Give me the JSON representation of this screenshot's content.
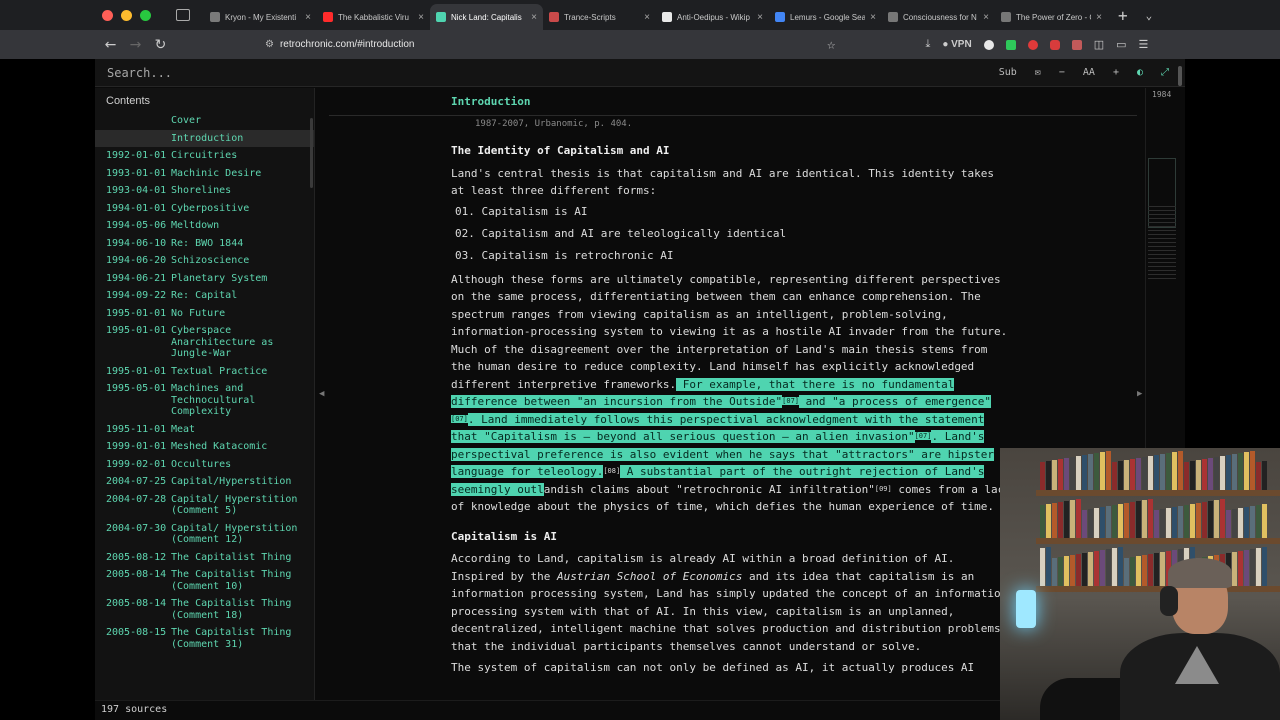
{
  "browser": {
    "tabs": [
      {
        "title": "Kryon - My Existenti",
        "color": "#7a7a7a",
        "active": false
      },
      {
        "title": "The Kabbalistic Viru",
        "color": "#ff2b2b",
        "active": false
      },
      {
        "title": "Nick Land: Capitalis",
        "color": "#4fd4b0",
        "active": true
      },
      {
        "title": "Trance-Scripts",
        "color": "#c94a4a",
        "active": false
      },
      {
        "title": "Anti-Oedipus - Wikip",
        "color": "#e8e8e8",
        "active": false
      },
      {
        "title": "Lemurs - Google Sea",
        "color": "#4285f4",
        "active": false
      },
      {
        "title": "Consciousness for N",
        "color": "#777777",
        "active": false
      },
      {
        "title": "The Power of Zero - Chr",
        "color": "#777777",
        "active": false
      }
    ],
    "url": "retrochronic.com/#introduction",
    "vpn_label": "VPN"
  },
  "app": {
    "search_placeholder": "Search...",
    "toolbar": {
      "sub_label": "Sub",
      "font_label": "AA"
    },
    "sidebar_title": "Contents",
    "toc": [
      {
        "date": "",
        "title": "Cover"
      },
      {
        "date": "",
        "title": "Introduction",
        "active": true
      },
      {
        "date": "1992-01-01",
        "title": "Circuitries"
      },
      {
        "date": "1993-01-01",
        "title": "Machinic Desire"
      },
      {
        "date": "1993-04-01",
        "title": "Shorelines"
      },
      {
        "date": "1994-01-01",
        "title": "Cyberpositive"
      },
      {
        "date": "1994-05-06",
        "title": "Meltdown"
      },
      {
        "date": "1994-06-10",
        "title": "Re: BWO 1844"
      },
      {
        "date": "1994-06-20",
        "title": "Schizoscience"
      },
      {
        "date": "1994-06-21",
        "title": "Planetary System"
      },
      {
        "date": "1994-09-22",
        "title": "Re: Capital"
      },
      {
        "date": "1995-01-01",
        "title": "No Future"
      },
      {
        "date": "1995-01-01",
        "title": "Cyberspace Anarchitecture as Jungle-War"
      },
      {
        "date": "1995-01-01",
        "title": "Textual Practice"
      },
      {
        "date": "1995-05-01",
        "title": "Machines and Technocultural Complexity"
      },
      {
        "date": "1995-11-01",
        "title": "Meat"
      },
      {
        "date": "1999-01-01",
        "title": "Meshed Katacomic"
      },
      {
        "date": "1999-02-01",
        "title": "Occultures"
      },
      {
        "date": "2004-07-25",
        "title": "Capital/Hyperstition"
      },
      {
        "date": "2004-07-28",
        "title": "Capital/ Hyperstition (Comment 5)"
      },
      {
        "date": "2004-07-30",
        "title": "Capital/ Hyperstition (Comment 12)"
      },
      {
        "date": "2005-08-12",
        "title": "The Capitalist Thing"
      },
      {
        "date": "2005-08-14",
        "title": "The Capitalist Thing (Comment 10)"
      },
      {
        "date": "2005-08-14",
        "title": "The Capitalist Thing (Comment 18)"
      },
      {
        "date": "2005-08-15",
        "title": "The Capitalist Thing (Comment 31)"
      }
    ],
    "sources_count": "197 sources",
    "section_title": "Introduction",
    "minimap_year": "1984"
  },
  "article": {
    "ref_line": "1987-2007, Urbanomic, p. 404.",
    "h_identity": "The Identity of Capitalism and AI",
    "intro": "Land's central thesis is that capitalism and AI are identical. This identity takes at least three different forms:",
    "forms": [
      "01. Capitalism is AI",
      "02. Capitalism and AI are teleologically identical",
      "03. Capitalism is retrochronic AI"
    ],
    "p1_plain": "Although these forms are ultimately compatible, representing different perspectives on the same process, differentiating between them can enhance comprehension. The spectrum ranges from viewing capitalism as an intelligent, problem-solving, information-processing system to viewing it as a hostile AI invader from the future. Much of the disagreement over the interpretation of Land's main thesis stems from the human desire to reduce complexity. Land himself has explicitly acknowledged different interpretive frameworks.",
    "p1_hl_a": " For example, that there is no fundamental difference between \"an incursion from the Outside\"",
    "p1_sup1": "[07]",
    "p1_hl_b": " and \"a process of emergence\"",
    "p1_sup2": "[07]",
    "p1_hl_c": ". Land immediately follows this perspectival acknowledgment with the statement that \"Capitalism is — beyond all serious question — an alien invasion\"",
    "p1_sup3": "[07]",
    "p1_hl_d": ". Land's perspectival preference is also evident when he says that \"attractors\" are hipster language for teleology.",
    "p1_sup4": "[08]",
    "p1_hl_e": " A substantial part of the outright rejection of Land's seemingly outl",
    "p1_tail": "andish claims about \"retrochronic AI infiltration\"",
    "p1_sup5": "[09]",
    "p1_end": " comes from a lack of knowledge about the physics of time, which defies the human experience of time.",
    "h_capai": "Capitalism is AI",
    "p2_a": "According to Land, capitalism is already AI within a broad definition of AI. Inspired by the ",
    "p2_em": "Austrian School of Economics",
    "p2_b": " and its idea that capitalism is an information processing system, Land has simply updated the concept of an information processing system with that of AI. In this view, capitalism is an unplanned, decentralized, intelligent machine that solves production and distribution problems that the individual participants themselves cannot understand or solve.",
    "p3": "The system of capitalism can not only be defined as AI, it actually produces AI"
  }
}
